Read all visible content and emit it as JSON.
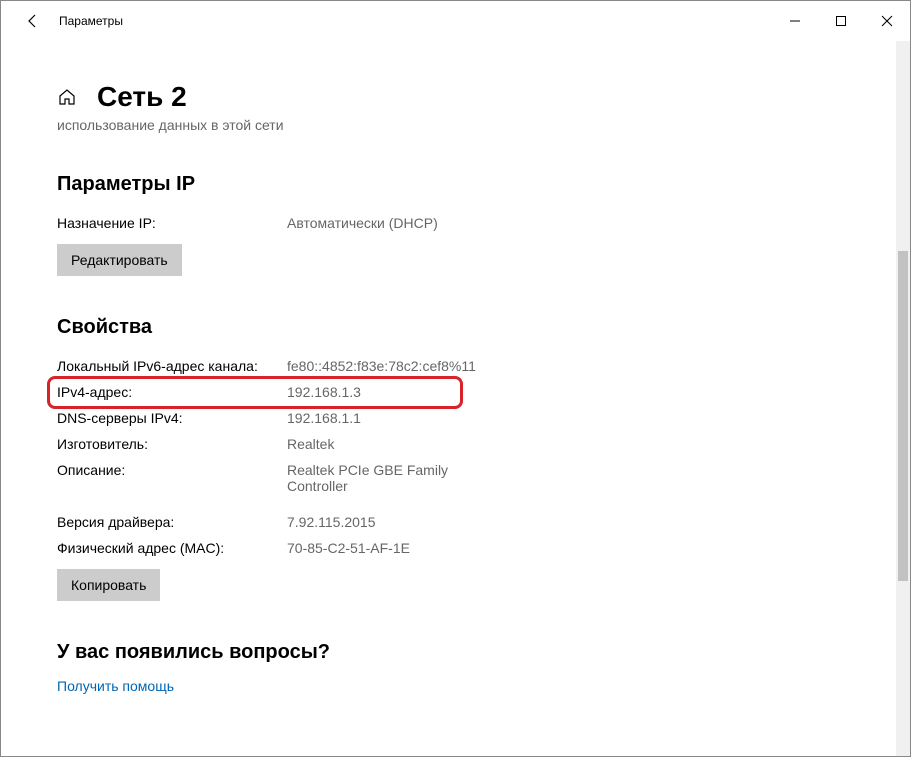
{
  "window": {
    "title": "Параметры"
  },
  "header": {
    "page_title": "Сеть 2",
    "subcaption": "использование данных в этой сети"
  },
  "ip_params": {
    "heading": "Параметры IP",
    "assignment_label": "Назначение IP:",
    "assignment_value": "Автоматически (DHCP)",
    "edit_button": "Редактировать"
  },
  "properties": {
    "heading": "Свойства",
    "rows": [
      {
        "label": "Локальный IPv6-адрес канала:",
        "value": "fe80::4852:f83e:78c2:cef8%11"
      },
      {
        "label": "IPv4-адрес:",
        "value": "192.168.1.3"
      },
      {
        "label": "DNS-серверы IPv4:",
        "value": "192.168.1.1"
      },
      {
        "label": "Изготовитель:",
        "value": "Realtek"
      },
      {
        "label": "Описание:",
        "value": "Realtek PCIe GBE Family Controller"
      },
      {
        "label": "Версия драйвера:",
        "value": "7.92.115.2015"
      },
      {
        "label": "Физический адрес (MAC):",
        "value": "70-85-C2-51-AF-1E"
      }
    ],
    "copy_button": "Копировать"
  },
  "help": {
    "heading": "У вас появились вопросы?",
    "link": "Получить помощь"
  }
}
